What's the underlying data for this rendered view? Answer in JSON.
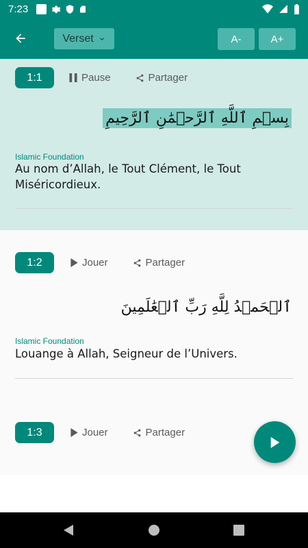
{
  "status_bar": {
    "time": "7:23"
  },
  "app_bar": {
    "verse_dropdown_label": "Verset",
    "font_decrease_label": "A-",
    "font_increase_label": "A+"
  },
  "colors": {
    "primary": "#00897b",
    "active_verse_bg": "#d2ebe7",
    "highlight": "#7ecbc1"
  },
  "verses": [
    {
      "number": "1:1",
      "action_label": "Pause",
      "action_icon": "pause-icon",
      "share_label": "Partager",
      "arabic": "بِسۡمِ ٱللَّهِ ٱلرَّحۡمَٰنِ ٱلرَّحِيمِ",
      "source": "Islamic Foundation",
      "translation": "Au nom d’Allah, le Tout Clément, le Tout Miséricordieux."
    },
    {
      "number": "1:2",
      "action_label": "Jouer",
      "action_icon": "play-icon",
      "share_label": "Partager",
      "arabic": "ٱلۡحَمۡدُ لِلَّهِ رَبِّ ٱلۡعَٰلَمِينَ",
      "source": "Islamic Foundation",
      "translation": "Louange à Allah, Seigneur de l’Univers."
    },
    {
      "number": "1:3",
      "action_label": "Jouer",
      "action_icon": "play-icon",
      "share_label": "Partager"
    }
  ]
}
